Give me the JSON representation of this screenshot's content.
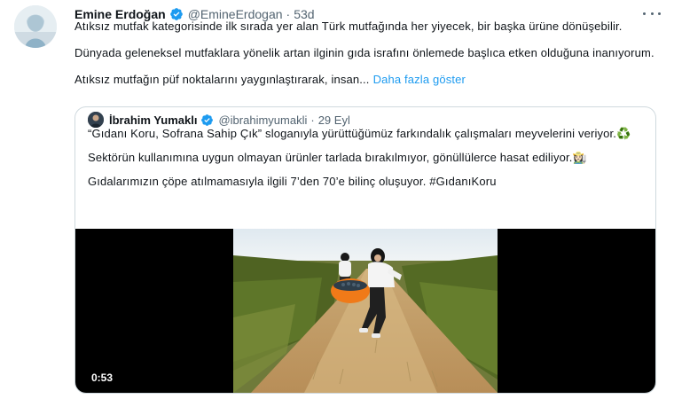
{
  "tweet": {
    "author_name": "Emine Erdoğan",
    "handle": "@EmineErdogan",
    "separator": "·",
    "time": "53d",
    "paragraphs": [
      "Atıksız mutfak kategorisinde ilk sırada yer alan Türk mutfağında her yiyecek, bir başka ürüne dönüşebilir.",
      "Dünyada geleneksel mutfaklara yönelik artan ilginin gıda israfını önlemede başlıca etken olduğuna inanıyorum.",
      "Atıksız mutfağın püf noktalarını yaygınlaştırarak, insan..."
    ],
    "show_more_label": "Daha fazla göster"
  },
  "quote": {
    "author_name": "İbrahim Yumaklı",
    "handle": "@ibrahimyumakli",
    "separator": "·",
    "time": "29 Eyl",
    "paragraphs": [
      "“Gıdanı Koru, Sofrana Sahip Çık” sloganıyla yürüttüğümüz farkındalık çalışmaları meyvelerini veriyor.♻️",
      "Sektörün kullanımına uygun olmayan ürünler tarlada bırakılmıyor, gönüllülerce hasat ediliyor.👩🏻‍🌾",
      "Gıdalarımızın çöpe atılmamasıyla ilgili 7’den 70’e bilinç oluşuyor. #GıdanıKoru"
    ],
    "video_duration": "0:53"
  },
  "icons": {
    "verified": "verified-badge-icon",
    "more": "more-options-icon"
  },
  "colors": {
    "verified_blue": "#1d9bf0",
    "link_blue": "#1d9bf0",
    "secondary_text": "#536471"
  }
}
